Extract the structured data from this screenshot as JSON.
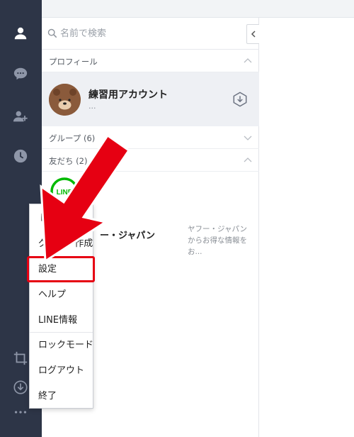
{
  "nav": {
    "items": [
      {
        "name": "friends",
        "icon": "person-icon"
      },
      {
        "name": "chats",
        "icon": "chat-bubble-icon"
      },
      {
        "name": "add-friend",
        "icon": "add-person-icon"
      },
      {
        "name": "timeline",
        "icon": "clock-icon"
      }
    ],
    "bottom": [
      {
        "name": "crop",
        "icon": "crop-icon"
      },
      {
        "name": "download",
        "icon": "download-icon"
      },
      {
        "name": "more",
        "icon": "more-dots-icon"
      }
    ]
  },
  "search": {
    "placeholder": "名前で検索"
  },
  "sections": {
    "profile": "プロフィール",
    "groups": "グループ (6)",
    "friends": "友だち (2)"
  },
  "profile": {
    "name": "練習用アカウント",
    "status": "..."
  },
  "friend": {
    "logo_text": "LINE",
    "name": "ー・ジャパン",
    "message": "ヤフー・ジャパンからお得な情報をお..."
  },
  "menu": {
    "items": [
      "トーク",
      "グループ作成",
      "設定",
      "ヘルプ",
      "LINE情報",
      "ロックモード",
      "ログアウト",
      "終了"
    ],
    "highlighted": "設定"
  },
  "colors": {
    "rail": "#2d3547",
    "rail_active_icon": "#ffffff",
    "rail_icon": "#8e96a8",
    "annotation_red": "#e60012",
    "line_green": "#00b900"
  }
}
